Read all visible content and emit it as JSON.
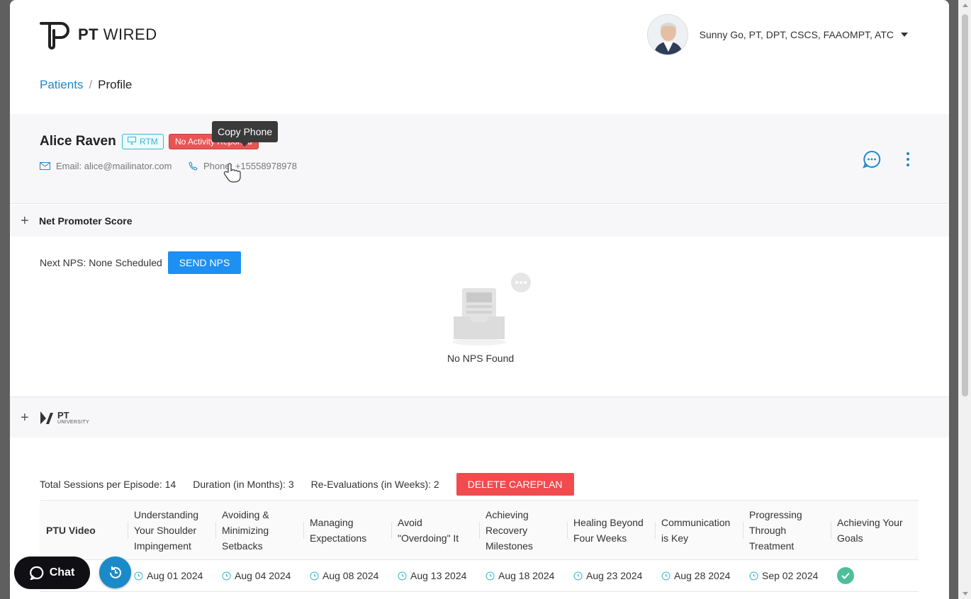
{
  "app": {
    "logo_text_bold": "PT",
    "logo_text_light": "WIRED"
  },
  "user": {
    "name": "Sunny Go, PT, DPT, CSCS, FAAOMPT, ATC"
  },
  "breadcrumb": {
    "link": "Patients",
    "separator": "/",
    "current": "Profile"
  },
  "patient": {
    "name": "Alice Raven",
    "tag_rtm": "RTM",
    "tag_status": "No Activity Reported",
    "email": "Email: alice@mailinator.com",
    "phone": "Phone: +15558978978",
    "tooltip": "Copy Phone"
  },
  "nps": {
    "section_title": "Net Promoter Score",
    "next_label": "Next NPS: None Scheduled",
    "send_button": "SEND NPS",
    "empty_text": "No NPS Found"
  },
  "ptu": {
    "logo_top": "PT",
    "logo_bottom": "UNIVERSITY",
    "sessions_label": "Total Sessions per Episode:",
    "sessions_value": "14",
    "duration_label": "Duration (in Months):",
    "duration_value": "3",
    "reeval_label": "Re-Evaluations (in Weeks):",
    "reeval_value": "2",
    "delete_button": "DELETE CAREPLAN",
    "row_header": "PTU Video",
    "columns": [
      "Understanding Your Shoulder Impingement",
      "Avoiding & Minimizing Setbacks",
      "Managing Expectations",
      "Avoid \"Overdoing\" It",
      "Achieving Recovery Milestones",
      "Healing Beyond Four Weeks",
      "Communication is Key",
      "Progressing Through Treatment",
      "Achieving Your Goals"
    ],
    "dates": [
      "Aug 01 2024",
      "Aug 04 2024",
      "Aug 08 2024",
      "Aug 13 2024",
      "Aug 18 2024",
      "Aug 23 2024",
      "Aug 28 2024",
      "Sep 02 2024"
    ]
  },
  "chat": {
    "label": "Chat"
  },
  "colors": {
    "accent": "#1e88c8",
    "danger": "#f04b4e",
    "primary_button": "#1e90f2",
    "success": "#4dc09b"
  }
}
